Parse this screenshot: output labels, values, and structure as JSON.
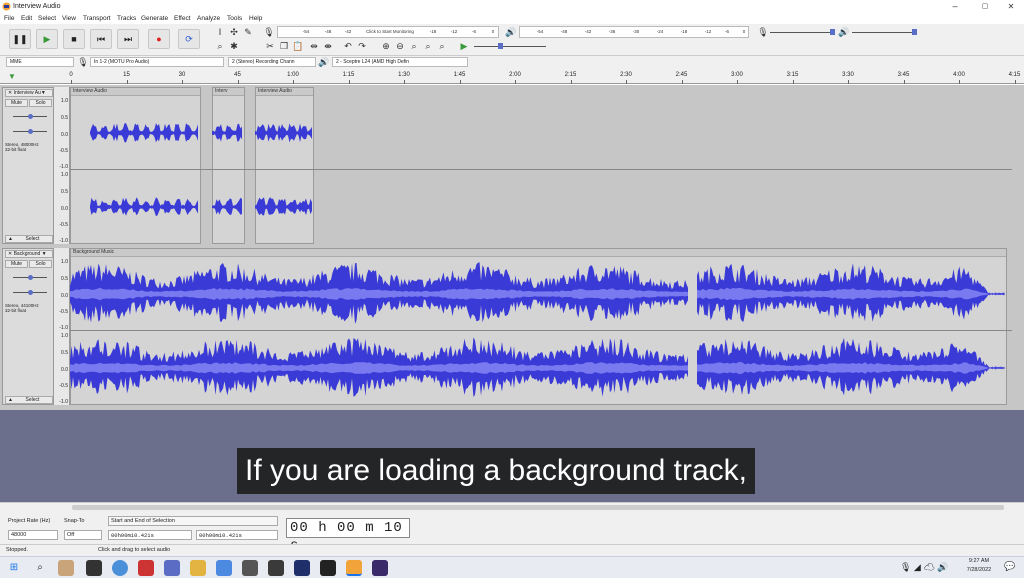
{
  "window": {
    "title": "Interview Audio",
    "minimize": "–",
    "maximize": "▢",
    "close": "✕"
  },
  "menu": [
    "File",
    "Edit",
    "Select",
    "View",
    "Transport",
    "Tracks",
    "Generate",
    "Effect",
    "Analyze",
    "Tools",
    "Help"
  ],
  "transport": {
    "pause": "❚❚",
    "play": "▶",
    "stop": "■",
    "skip_start": "⏮",
    "skip_end": "⏭",
    "record": "●",
    "loop": "⟳"
  },
  "meter": {
    "record_ticks": [
      "-54",
      "-48",
      "-42",
      "Click to Start Monitoring",
      "-18",
      "-12",
      "-6",
      "0"
    ],
    "playback_ticks": [
      "-54",
      "-48",
      "-42",
      "-36",
      "-30",
      "-24",
      "-18",
      "-12",
      "-6",
      "0"
    ]
  },
  "devices": {
    "host": "MME",
    "input": "In 1-2 (MOTU Pro Audio)",
    "channels": "2 (Stereo) Recording Chann",
    "output": "2 - Sceptre L24 (AMD High Defin"
  },
  "ruler": [
    "0",
    "15",
    "30",
    "45",
    "1:00",
    "1:15",
    "1:30",
    "1:45",
    "2:00",
    "2:15",
    "2:30",
    "2:45",
    "3:00",
    "3:15",
    "3:30",
    "3:45",
    "4:00",
    "4:15"
  ],
  "tracks": [
    {
      "name": "Interview Au▼",
      "mute": "Mute",
      "solo": "Solo",
      "info1": "Stereo, 48000Hz",
      "info2": "32-bit float",
      "select": "Select",
      "clips": [
        "Interview Audio",
        "Interv",
        "Interview Audio"
      ],
      "scale": [
        "1.0",
        "0.5",
        "0.0",
        "-0.5",
        "-1.0",
        "1.0",
        "0.5",
        "0.0",
        "-0.5",
        "-1.0"
      ]
    },
    {
      "name": "Background ▼",
      "mute": "Mute",
      "solo": "Solo",
      "info1": "Stereo, 44100Hz",
      "info2": "32-bit float",
      "select": "Select",
      "clips": [
        "Background Music"
      ],
      "scale": [
        "1.0",
        "0.5",
        "0.0",
        "-0.5",
        "-1.0",
        "1.0",
        "0.5",
        "0.0",
        "-0.5",
        "-1.0"
      ]
    }
  ],
  "subtitle": "If you are loading a background track,",
  "selection": {
    "rate_label": "Project Rate (Hz)",
    "rate": "48000",
    "snap_label": "Snap-To",
    "snap": "Off",
    "range_label": "Start and End of Selection",
    "start": "00h00m10.421s",
    "end": "00h00m10.421s",
    "big_time": "00 h 00 m 10 s"
  },
  "status": {
    "state": "Stopped.",
    "hint": "Click and drag to select audio"
  },
  "clock": {
    "time": "9:27 AM",
    "date": "7/28/2022"
  },
  "colors": {
    "waveform": "#3a3ad6",
    "waveform_rms": "#7a7af0",
    "subtitle_bg": "#6b6f8c"
  }
}
